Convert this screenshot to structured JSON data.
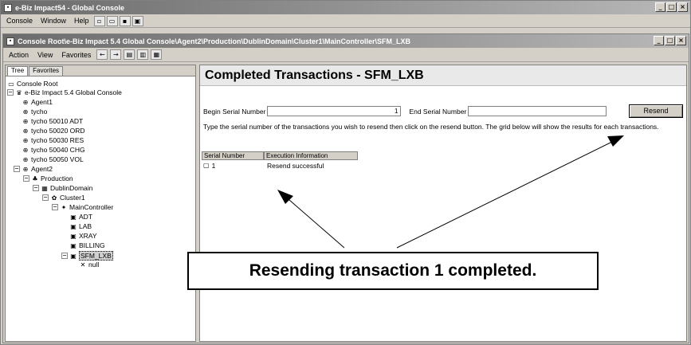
{
  "outer": {
    "title": "e-Biz Impact54 - Global Console",
    "menu": [
      "Console",
      "Window",
      "Help"
    ]
  },
  "inner": {
    "title": "Console Root\\e-Biz Impact 5.4 Global Console\\Agent2\\Production\\DublinDomain\\Cluster1\\MainController\\SFM_LXB",
    "menu": [
      "Action",
      "View",
      "Favorites"
    ]
  },
  "tree": {
    "tabs": [
      "Tree",
      "Favorites"
    ],
    "nodes": [
      {
        "label": "Console Root",
        "icon": "folder-icon"
      },
      {
        "label": "e-Biz Impact 5.4 Global Console",
        "icon": "console-icon"
      },
      {
        "label": "Agent1",
        "icon": "agent-icon"
      },
      {
        "label": "tycho",
        "icon": "agent-icon"
      },
      {
        "label": "tycho 50010 ADT",
        "icon": "agent-icon"
      },
      {
        "label": "tycho 50020 ORD",
        "icon": "agent-icon"
      },
      {
        "label": "tycho 50030 RES",
        "icon": "agent-icon"
      },
      {
        "label": "tycho 50040 CHG",
        "icon": "agent-icon"
      },
      {
        "label": "tycho 50050 VOL",
        "icon": "agent-icon"
      },
      {
        "label": "Agent2",
        "icon": "agent-icon"
      },
      {
        "label": "Production",
        "icon": "production-icon"
      },
      {
        "label": "DublinDomain",
        "icon": "domain-icon"
      },
      {
        "label": "Cluster1",
        "icon": "cluster-icon"
      },
      {
        "label": "MainController",
        "icon": "controller-icon"
      },
      {
        "label": "ADT",
        "icon": "service-icon"
      },
      {
        "label": "LAB",
        "icon": "service-icon"
      },
      {
        "label": "XRAY",
        "icon": "service-icon"
      },
      {
        "label": "BILLING",
        "icon": "service-icon"
      },
      {
        "label": "SFM_LXB",
        "icon": "service-icon"
      },
      {
        "label": "null",
        "icon": "service-icon"
      }
    ]
  },
  "content": {
    "heading": "Completed Transactions - SFM_LXB",
    "begin_label": "Begin Serial Number",
    "begin_value": "1",
    "end_label": "End Serial Number",
    "end_value": "",
    "resend_label": "Resend",
    "instructions": "Type the serial number of the transactions you wish to resend then click on the resend button. The grid below will show the results for each transactions.",
    "grid": {
      "columns": [
        "Serial Number",
        "Execution Information"
      ],
      "rows": [
        {
          "serial": "1",
          "info": "Resend successful"
        }
      ]
    }
  },
  "callout": {
    "text": "Resending transaction 1 completed."
  }
}
